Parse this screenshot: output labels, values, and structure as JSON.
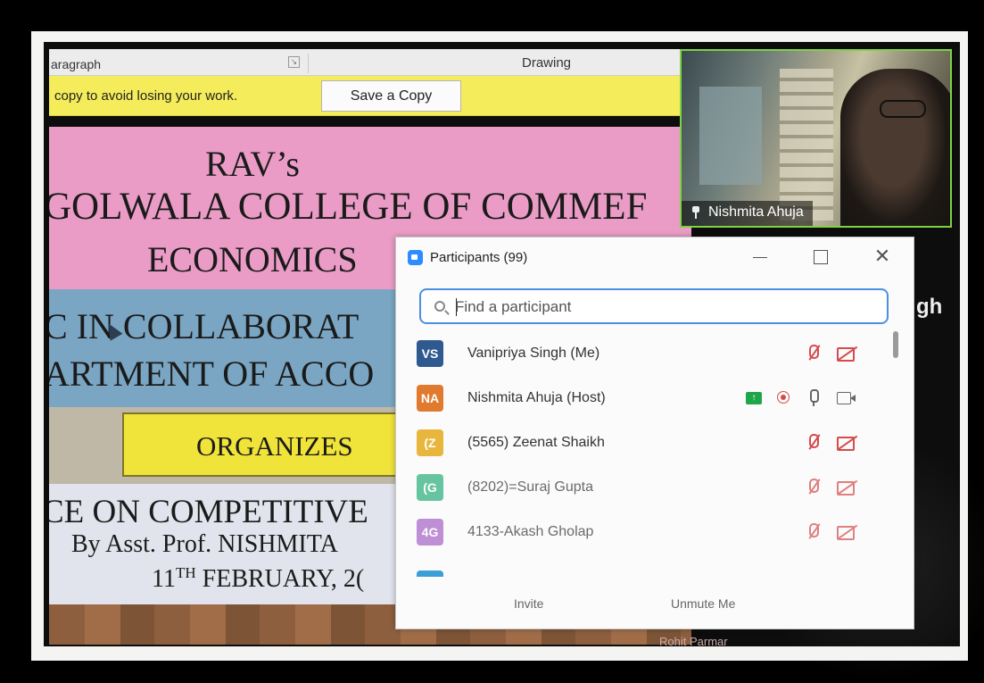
{
  "word": {
    "ribbon": {
      "group_paragraph": "aragraph",
      "group_drawing": "Drawing"
    },
    "infobar": {
      "message": "copy to avoid losing your work.",
      "save_copy_label": "Save a Copy"
    },
    "slide": {
      "line1": "RAV’s",
      "line2": "GOLWALA COLLEGE OF COMMEF",
      "line3": "ECONOMICS",
      "line4": "C IN COLLABORAT",
      "line5": "ARTMENT OF ACCO",
      "line6": "ORGANIZES",
      "line7": "CE ON COMPETITIVE",
      "line8": "By Asst. Prof. NISHMITA",
      "line9_main": "11",
      "line9_sup": "TH",
      "line9_rest": " FEBRUARY, 2("
    }
  },
  "video": {
    "participant_name": "Nishmita Ahuja"
  },
  "side_text": "gh",
  "participants_panel": {
    "title": "Participants (99)",
    "search_placeholder": "Find a participant",
    "participants": [
      {
        "initials": "VS",
        "name": "Vanipriya Singh (Me)",
        "color": "#2f5a8f",
        "status": "muted-video-off"
      },
      {
        "initials": "NA",
        "name": "Nishmita Ahuja (Host)",
        "color": "#e07a2f",
        "status": "host-sharing-recording"
      },
      {
        "initials": "(Z",
        "name": "(5565) Zeenat Shaikh",
        "color": "#e8b63c",
        "status": "muted-video-off"
      },
      {
        "initials": "(G",
        "name": "(8202)=Suraj Gupta",
        "color": "#2fb07e",
        "status": "muted-video-off"
      },
      {
        "initials": "4G",
        "name": "4133-Akash Gholap",
        "color": "#a866c8",
        "status": "muted-video-off"
      }
    ],
    "footer": {
      "invite_label": "Invite",
      "unmute_label": "Unmute Me"
    }
  },
  "bottom_partial_name": "Rohit Parmar"
}
